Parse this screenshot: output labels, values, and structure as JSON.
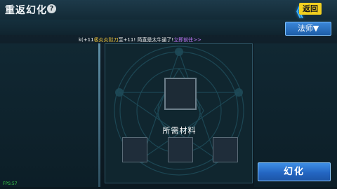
{
  "header": {
    "title": "重返幻化",
    "help_symbol": "?",
    "back_chevrons": "《",
    "back_label": "返回"
  },
  "filter": {
    "class_selected": "法师▼"
  },
  "announcement": {
    "part1": "k(+11",
    "part2": "极炎炎狱刀",
    "part3": "至+11! 简直是太牛逼了!",
    "part4": "立即前往>>"
  },
  "workbench": {
    "materials_label": "所需材料"
  },
  "actions": {
    "convert_label": "幻化"
  },
  "debug": {
    "fps": "FPS:57"
  },
  "colors": {
    "accent_blue": "#3f8fe6",
    "back_label_yellow": "#f2d020",
    "announce_gold": "#f0c43a",
    "announce_purple": "#c67aff",
    "fps_green": "#38d04a"
  },
  "icons": {
    "help": "help-icon",
    "back": "double-chevron-left-icon"
  }
}
